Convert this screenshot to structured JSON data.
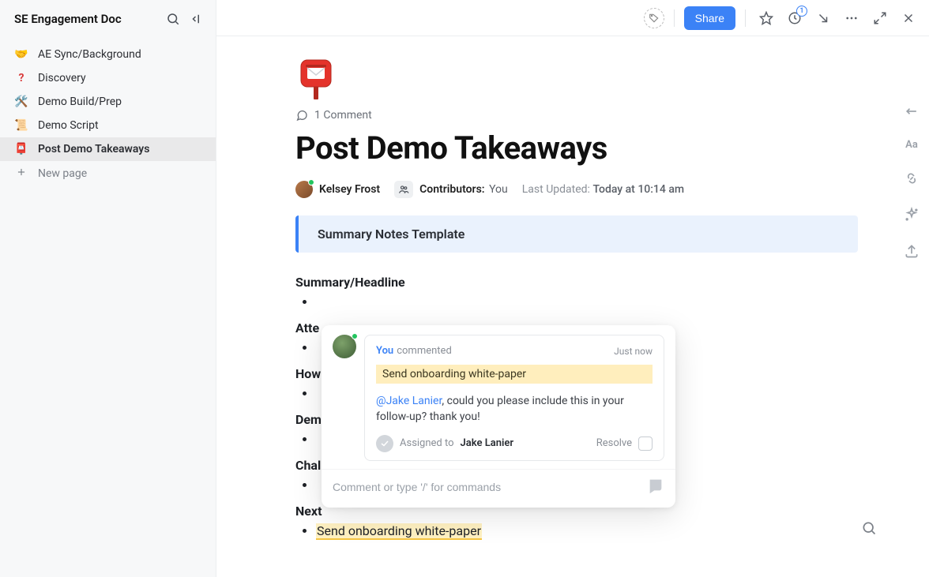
{
  "sidebar": {
    "title": "SE Engagement Doc",
    "items": [
      {
        "emoji": "🤝",
        "label": "AE Sync/Background",
        "active": false
      },
      {
        "emoji": "❓",
        "label": "Discovery",
        "active": false,
        "emojiColor": "#d83a3a"
      },
      {
        "emoji": "🛠️",
        "label": "Demo Build/Prep",
        "active": false
      },
      {
        "emoji": "📜",
        "label": "Demo Script",
        "active": false
      },
      {
        "emoji": "📮",
        "label": "Post Demo Takeaways",
        "active": true
      }
    ],
    "newPage": "New page"
  },
  "toolbar": {
    "share": "Share",
    "notifCount": "1"
  },
  "doc": {
    "commentCount": "1 Comment",
    "title": "Post Demo Takeaways",
    "author": "Kelsey Frost",
    "contributorsLabel": "Contributors:",
    "contributorsValue": "You",
    "updatedLabel": "Last Updated:",
    "updatedValue": "Today at 10:14 am",
    "callout": "Summary Notes Template",
    "sections": [
      "Summary/Headline",
      "Atte",
      "How",
      "Dem",
      "Chal",
      "Next"
    ],
    "highlightedItem": "Send onboarding white-paper"
  },
  "comment": {
    "you": "You",
    "action": "commented",
    "time": "Just now",
    "quote": "Send onboarding white-paper",
    "mention": "@Jake Lanier",
    "text": ", could you please include this in your follow-up? thank you!",
    "assignedLabel": "Assigned to",
    "assignee": "Jake Lanier",
    "resolve": "Resolve",
    "placeholder": "Comment or type '/' for commands"
  }
}
